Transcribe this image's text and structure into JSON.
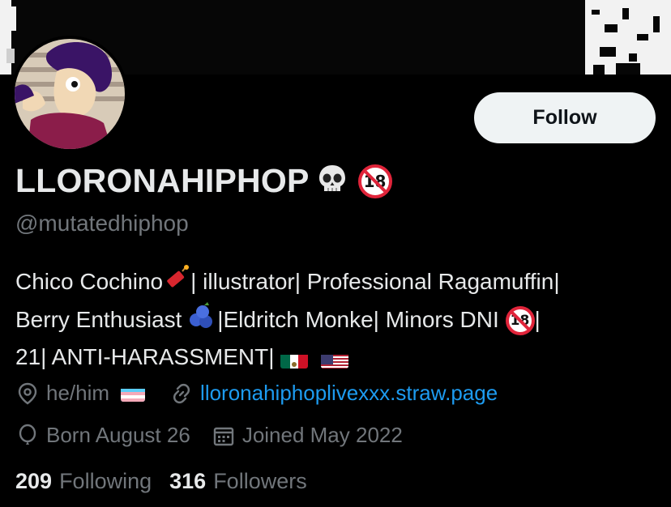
{
  "banner": {
    "icon": "banner-image"
  },
  "avatar": {
    "icon": "avatar-illustration"
  },
  "follow": {
    "label": "Follow"
  },
  "profile": {
    "display_name": "LLORONAHIPHOP",
    "handle": "@mutatedhiphop",
    "name_emojis": [
      "skull-emoji",
      "no-one-under-18-emoji"
    ]
  },
  "bio": {
    "line1_a": "Chico Cochino",
    "line1_b": "| illustrator| Professional Ragamuffin|",
    "line2_a": "Berry Enthusiast ",
    "line2_b": "|Eldritch Monke| Minors DNI ",
    "line2_c": "|",
    "line3_a": "21| ANTI-HARASSMENT| ",
    "emojis": [
      "firecracker-emoji",
      "blueberries-emoji",
      "no-one-under-18-emoji",
      "mexico-flag",
      "us-flag"
    ]
  },
  "meta": {
    "pronouns": "he/him",
    "website": "lloronahiphoplivexxx.straw.page",
    "birthday": "Born August 26",
    "joined": "Joined May 2022"
  },
  "stats": {
    "following_count": "209",
    "following_label": "Following",
    "followers_count": "316",
    "followers_label": "Followers"
  },
  "colors": {
    "background": "#000000",
    "text": "#e7e9ea",
    "secondary": "#71767b",
    "link": "#1d9bf0",
    "button_bg": "#eff3f4"
  }
}
